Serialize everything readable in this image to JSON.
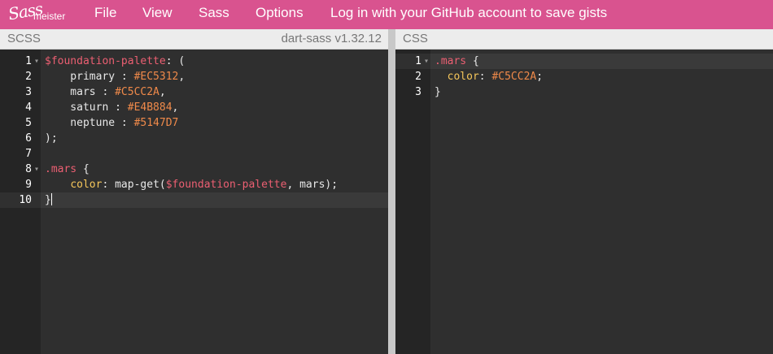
{
  "brand": {
    "script": "Sass",
    "word": "meister"
  },
  "nav": {
    "file": "File",
    "view": "View",
    "sass": "Sass",
    "options": "Options",
    "login": "Log in with your GitHub account to save gists"
  },
  "scss_panel": {
    "title": "SCSS",
    "compiler": "dart-sass v1.32.12",
    "line_numbers": [
      "1",
      "2",
      "3",
      "4",
      "5",
      "6",
      "7",
      "8",
      "9",
      "10"
    ],
    "lines": [
      {
        "tokens": [
          {
            "t": "$foundation-palette",
            "c": "var"
          },
          {
            "t": ": (",
            "c": "txt"
          }
        ]
      },
      {
        "tokens": [
          {
            "t": "    primary : ",
            "c": "txt"
          },
          {
            "t": "#EC5312",
            "c": "color"
          },
          {
            "t": ",",
            "c": "txt"
          }
        ]
      },
      {
        "tokens": [
          {
            "t": "    mars : ",
            "c": "txt"
          },
          {
            "t": "#C5CC2A",
            "c": "color"
          },
          {
            "t": ",",
            "c": "txt"
          }
        ]
      },
      {
        "tokens": [
          {
            "t": "    saturn : ",
            "c": "txt"
          },
          {
            "t": "#E4B884",
            "c": "color"
          },
          {
            "t": ",",
            "c": "txt"
          }
        ]
      },
      {
        "tokens": [
          {
            "t": "    neptune : ",
            "c": "txt"
          },
          {
            "t": "#5147D7",
            "c": "color"
          }
        ]
      },
      {
        "tokens": [
          {
            "t": ");",
            "c": "txt"
          }
        ]
      },
      {
        "tokens": []
      },
      {
        "tokens": [
          {
            "t": ".mars",
            "c": "sel"
          },
          {
            "t": " {",
            "c": "txt"
          }
        ]
      },
      {
        "tokens": [
          {
            "t": "    ",
            "c": "txt"
          },
          {
            "t": "color",
            "c": "prop"
          },
          {
            "t": ": map-get(",
            "c": "txt"
          },
          {
            "t": "$foundation-palette",
            "c": "var"
          },
          {
            "t": ", mars);",
            "c": "txt"
          }
        ]
      },
      {
        "tokens": [
          {
            "t": "}",
            "c": "txt"
          }
        ]
      }
    ],
    "folds": [
      "1",
      "8"
    ],
    "active_line": "10"
  },
  "css_panel": {
    "title": "CSS",
    "line_numbers": [
      "1",
      "2",
      "3"
    ],
    "lines": [
      {
        "tokens": [
          {
            "t": ".mars",
            "c": "sel"
          },
          {
            "t": " {",
            "c": "txt"
          }
        ]
      },
      {
        "tokens": [
          {
            "t": "  ",
            "c": "txt"
          },
          {
            "t": "color",
            "c": "prop"
          },
          {
            "t": ": ",
            "c": "txt"
          },
          {
            "t": "#C5CC2A",
            "c": "color"
          },
          {
            "t": ";",
            "c": "txt"
          }
        ]
      },
      {
        "tokens": [
          {
            "t": "}",
            "c": "txt"
          }
        ]
      }
    ],
    "folds": [
      "1"
    ],
    "active_line": "1"
  },
  "colors": {
    "topbar": "#d9538f",
    "editor_bg": "#2f2f2f",
    "gutter_bg": "#252525",
    "variable": "#ec5f72",
    "hex_value": "#f08a4a",
    "property": "#f5c65a"
  }
}
